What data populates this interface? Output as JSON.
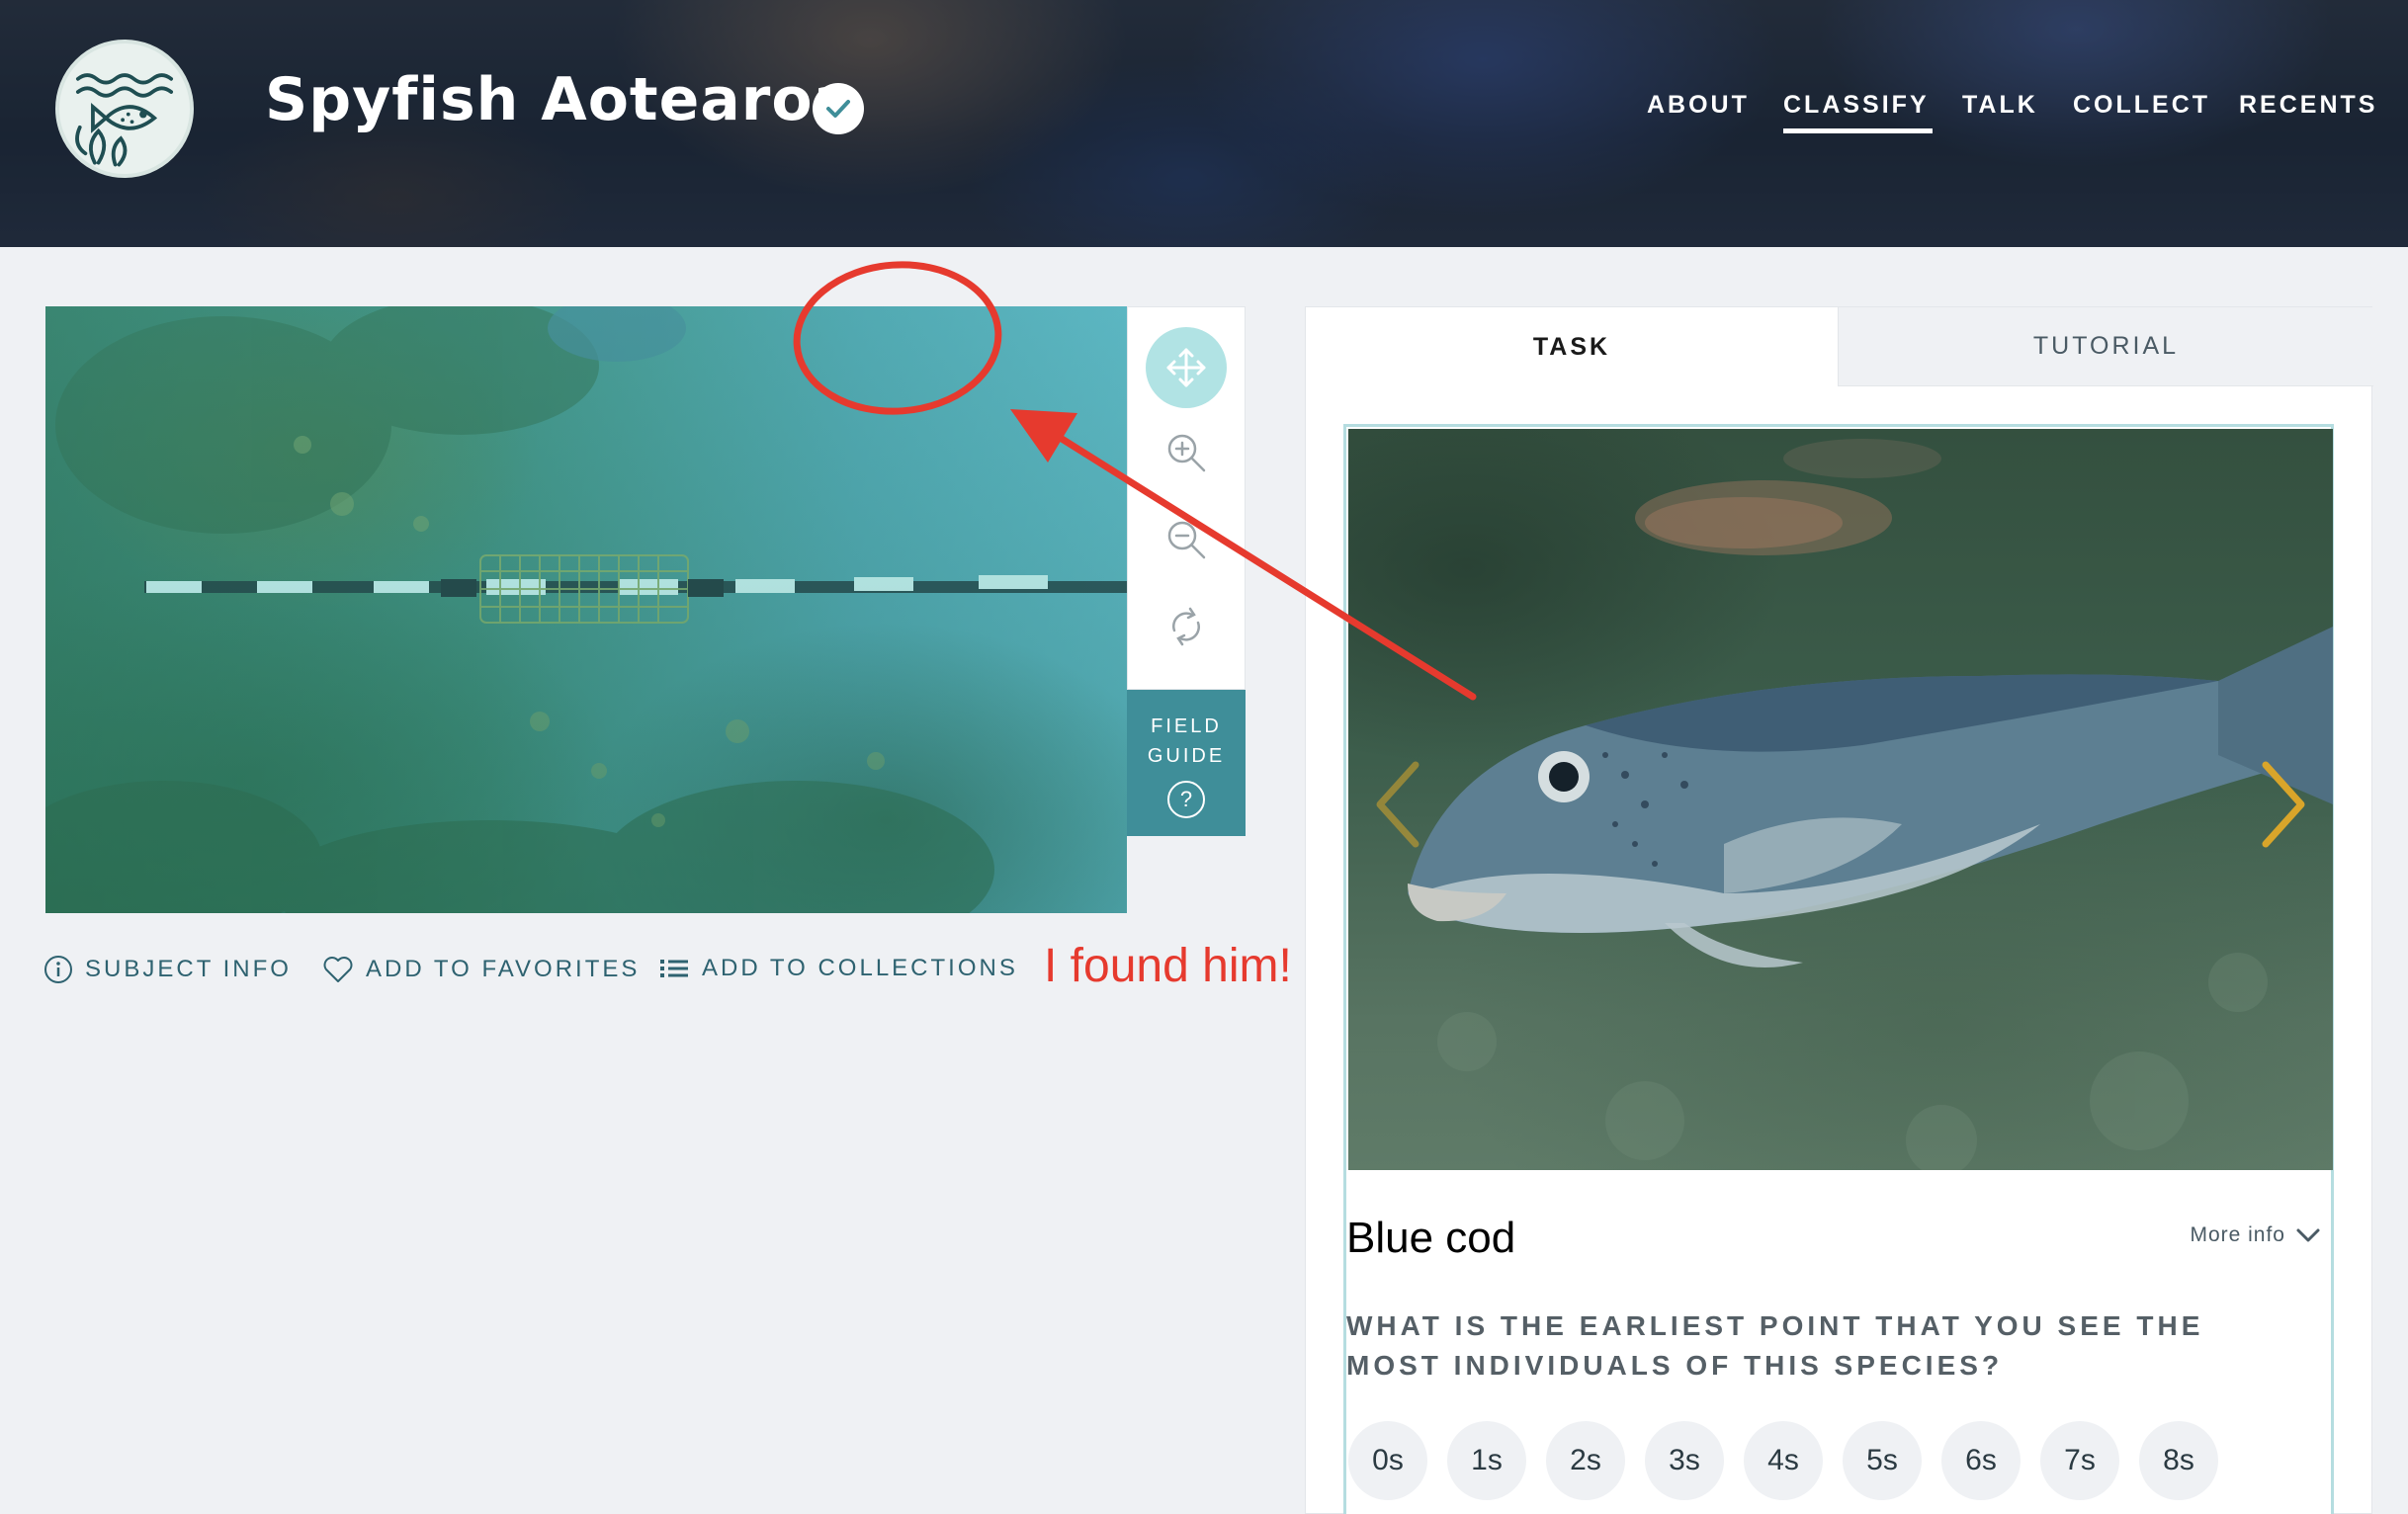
{
  "header": {
    "site_title": "Spyfish Aotearoa",
    "nav": [
      {
        "label": "ABOUT",
        "active": false
      },
      {
        "label": "CLASSIFY",
        "active": true
      },
      {
        "label": "TALK",
        "active": false
      },
      {
        "label": "COLLECT",
        "active": false
      },
      {
        "label": "RECENTS",
        "active": false
      }
    ]
  },
  "viewer": {
    "tools": [
      "move-icon",
      "zoom-in-icon",
      "zoom-out-icon",
      "reset-icon"
    ],
    "field_guide": {
      "line1": "FIELD",
      "line2": "GUIDE",
      "icon": "?"
    }
  },
  "meta_bar": {
    "subject_info": "SUBJECT INFO",
    "add_to_favorites": "ADD TO FAVORITES",
    "add_to_collections": "ADD TO COLLECTIONS"
  },
  "annotation": {
    "text": "I found him!",
    "color": "#e63a2e"
  },
  "task_panel": {
    "tabs": {
      "task": "TASK",
      "tutorial": "TUTORIAL"
    },
    "species_name": "Blue cod",
    "more_info": "More info",
    "question": "WHAT IS THE EARLIEST POINT THAT YOU SEE THE MOST INDIVIDUALS OF THIS SPECIES?",
    "answers": [
      "0s",
      "1s",
      "2s",
      "3s",
      "4s",
      "5s",
      "6s",
      "7s",
      "8s"
    ]
  },
  "colors": {
    "accent_teal": "#3f8e99",
    "active_tool": "#b1e3e4",
    "carousel_chevron": "#d9a52a"
  }
}
